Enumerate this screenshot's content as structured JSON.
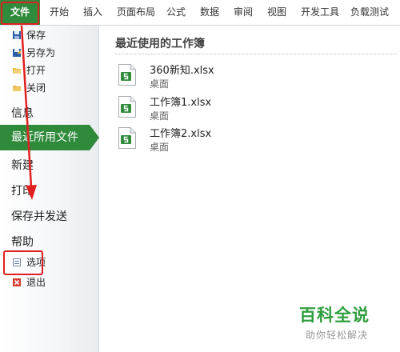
{
  "ribbon": {
    "tabs": [
      "文件",
      "开始",
      "插入",
      "页面布局",
      "公式",
      "数据",
      "审阅",
      "视图",
      "开发工具",
      "负载测试"
    ]
  },
  "nav": {
    "commands_top": [
      {
        "label": "保存",
        "icon": "save-icon"
      },
      {
        "label": "另存为",
        "icon": "save-as-icon"
      },
      {
        "label": "打开",
        "icon": "open-folder-icon"
      },
      {
        "label": "关闭",
        "icon": "close-folder-icon"
      }
    ],
    "info": "信息",
    "recent": "最近所用文件",
    "new": "新建",
    "print": "打印",
    "save_send": "保存并发送",
    "help": "帮助",
    "options": {
      "label": "选项",
      "icon": "options-icon"
    },
    "exit": {
      "label": "退出",
      "icon": "exit-icon"
    }
  },
  "main": {
    "title": "最近使用的工作簿",
    "files": [
      {
        "name": "360新知.xlsx",
        "location": "桌面"
      },
      {
        "name": "工作簿1.xlsx",
        "location": "桌面"
      },
      {
        "name": "工作簿2.xlsx",
        "location": "桌面"
      }
    ]
  },
  "watermark": {
    "title": "百科全说",
    "subtitle": "助你轻松解决"
  },
  "colors": {
    "accent_green": "#2f8a3c",
    "annotation_red": "#e02020"
  }
}
